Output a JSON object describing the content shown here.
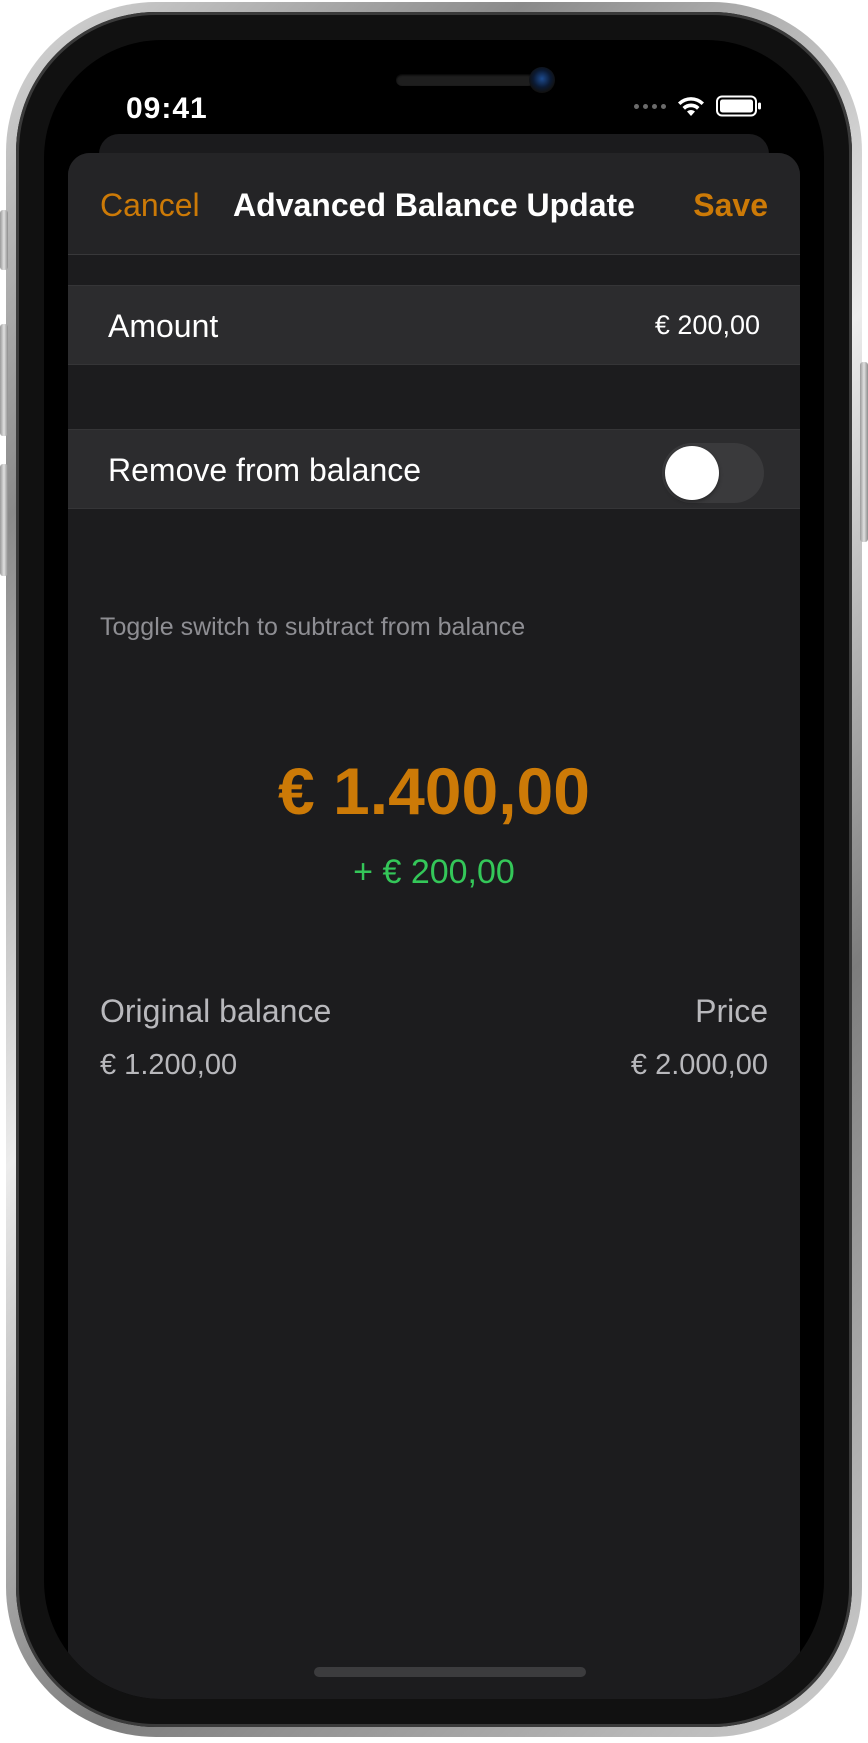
{
  "status_bar": {
    "time": "09:41",
    "icons": [
      "cellular-dots-icon",
      "wifi-icon",
      "battery-icon"
    ]
  },
  "nav": {
    "cancel_label": "Cancel",
    "title": "Advanced Balance Update",
    "save_label": "Save"
  },
  "form": {
    "amount_label": "Amount",
    "amount_value": "€ 200,00",
    "remove_label": "Remove from balance",
    "remove_enabled": false,
    "remove_footer": "Toggle switch to subtract from balance"
  },
  "summary": {
    "new_balance": "€ 1.400,00",
    "delta": "+ € 200,00",
    "original_label": "Original balance",
    "original_value": "€ 1.200,00",
    "price_label": "Price",
    "price_value": "€ 2.000,00"
  },
  "colors": {
    "accent": "#cc7a07",
    "positive": "#34c759",
    "background": "#1c1c1e",
    "cell": "#2c2c2e",
    "secondary_text": "#8e8e93"
  }
}
